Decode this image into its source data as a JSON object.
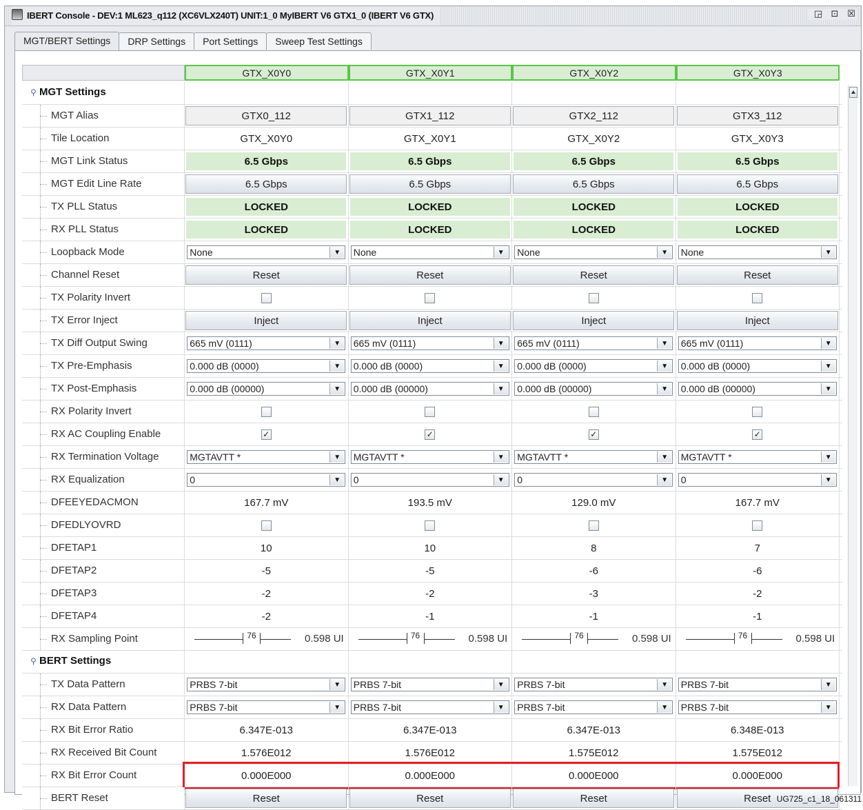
{
  "window": {
    "title": "IBERT Console - DEV:1 ML623_q112 (XC6VLX240T) UNIT:1_0 MyIBERT V6 GTX1_0 (IBERT V6 GTX)",
    "buttons": [
      "◲",
      "⊡",
      "☒"
    ]
  },
  "tabs": [
    "MGT/BERT Settings",
    "DRP Settings",
    "Port Settings",
    "Sweep Test Settings"
  ],
  "columns": [
    "GTX_X0Y0",
    "GTX_X0Y1",
    "GTX_X0Y2",
    "GTX_X0Y3"
  ],
  "sections": {
    "mgt": "MGT Settings",
    "bert": "BERT Settings"
  },
  "rows": [
    {
      "label": "MGT Alias",
      "kind": "alias",
      "values": [
        "GTX0_112",
        "GTX1_112",
        "GTX2_112",
        "GTX3_112"
      ]
    },
    {
      "label": "Tile Location",
      "kind": "text",
      "values": [
        "GTX_X0Y0",
        "GTX_X0Y1",
        "GTX_X0Y2",
        "GTX_X0Y3"
      ]
    },
    {
      "label": "MGT Link Status",
      "kind": "status",
      "values": [
        "6.5 Gbps",
        "6.5 Gbps",
        "6.5 Gbps",
        "6.5 Gbps"
      ]
    },
    {
      "label": "MGT Edit Line Rate",
      "kind": "button",
      "values": [
        "6.5 Gbps",
        "6.5 Gbps",
        "6.5 Gbps",
        "6.5 Gbps"
      ]
    },
    {
      "label": "TX PLL Status",
      "kind": "status",
      "values": [
        "LOCKED",
        "LOCKED",
        "LOCKED",
        "LOCKED"
      ]
    },
    {
      "label": "RX PLL Status",
      "kind": "status",
      "values": [
        "LOCKED",
        "LOCKED",
        "LOCKED",
        "LOCKED"
      ]
    },
    {
      "label": "Loopback Mode",
      "kind": "combo",
      "values": [
        "None",
        "None",
        "None",
        "None"
      ]
    },
    {
      "label": "Channel Reset",
      "kind": "button",
      "values": [
        "Reset",
        "Reset",
        "Reset",
        "Reset"
      ]
    },
    {
      "label": "TX Polarity Invert",
      "kind": "check",
      "values": [
        "",
        "",
        "",
        ""
      ]
    },
    {
      "label": "TX Error Inject",
      "kind": "button",
      "values": [
        "Inject",
        "Inject",
        "Inject",
        "Inject"
      ]
    },
    {
      "label": "TX Diff Output Swing",
      "kind": "combo",
      "values": [
        "665 mV (0111)",
        "665 mV (0111)",
        "665 mV (0111)",
        "665 mV (0111)"
      ]
    },
    {
      "label": "TX Pre-Emphasis",
      "kind": "combo",
      "values": [
        "0.000 dB (0000)",
        "0.000 dB (0000)",
        "0.000 dB (0000)",
        "0.000 dB (0000)"
      ]
    },
    {
      "label": "TX Post-Emphasis",
      "kind": "combo",
      "values": [
        "0.000 dB (00000)",
        "0.000 dB (00000)",
        "0.000 dB (00000)",
        "0.000 dB (00000)"
      ]
    },
    {
      "label": "RX Polarity Invert",
      "kind": "check",
      "values": [
        "",
        "",
        "",
        ""
      ]
    },
    {
      "label": "RX AC Coupling Enable",
      "kind": "check",
      "values": [
        "✓",
        "✓",
        "✓",
        "✓"
      ]
    },
    {
      "label": "RX Termination Voltage",
      "kind": "combo",
      "values": [
        "MGTAVTT  *",
        "MGTAVTT  *",
        "MGTAVTT  *",
        "MGTAVTT  *"
      ]
    },
    {
      "label": "RX Equalization",
      "kind": "combo",
      "values": [
        "0",
        "0",
        "0",
        "0"
      ]
    },
    {
      "label": "DFEEYEDACMON",
      "kind": "text",
      "values": [
        "167.7 mV",
        "193.5 mV",
        "129.0 mV",
        "167.7 mV"
      ]
    },
    {
      "label": "DFEDLYOVRD",
      "kind": "check",
      "values": [
        "",
        "",
        "",
        ""
      ]
    },
    {
      "label": "DFETAP1",
      "kind": "text",
      "values": [
        "10",
        "10",
        "8",
        "7"
      ]
    },
    {
      "label": "DFETAP2",
      "kind": "text",
      "values": [
        "-5",
        "-5",
        "-6",
        "-6"
      ]
    },
    {
      "label": "DFETAP3",
      "kind": "text",
      "values": [
        "-2",
        "-2",
        "-3",
        "-2"
      ]
    },
    {
      "label": "DFETAP4",
      "kind": "text",
      "values": [
        "-2",
        "-1",
        "-1",
        "-1"
      ]
    },
    {
      "label": "RX Sampling Point",
      "kind": "slider",
      "values": [
        "76",
        "76",
        "76",
        "76"
      ],
      "units": [
        "0.598 UI",
        "0.598 UI",
        "0.598 UI",
        "0.598 UI"
      ]
    },
    {
      "section": "bert"
    },
    {
      "label": "TX Data Pattern",
      "kind": "combo",
      "values": [
        "PRBS 7-bit",
        "PRBS 7-bit",
        "PRBS 7-bit",
        "PRBS 7-bit"
      ]
    },
    {
      "label": "RX Data Pattern",
      "kind": "combo",
      "values": [
        "PRBS 7-bit",
        "PRBS 7-bit",
        "PRBS 7-bit",
        "PRBS 7-bit"
      ]
    },
    {
      "label": "RX Bit Error Ratio",
      "kind": "text",
      "values": [
        "6.347E-013",
        "6.347E-013",
        "6.347E-013",
        "6.348E-013"
      ]
    },
    {
      "label": "RX Received Bit Count",
      "kind": "text",
      "values": [
        "1.576E012",
        "1.576E012",
        "1.575E012",
        "1.575E012"
      ]
    },
    {
      "label": "RX Bit Error Count",
      "kind": "text",
      "values": [
        "0.000E000",
        "0.000E000",
        "0.000E000",
        "0.000E000"
      ]
    },
    {
      "label": "BERT Reset",
      "kind": "button",
      "values": [
        "Reset",
        "Reset",
        "Reset",
        "Reset"
      ]
    }
  ],
  "highlight_row": "RX Bit Error Count",
  "footer": "UG725_c1_18_061311",
  "colors": {
    "status_bg": "#d8edd2",
    "header_border": "#5cc44a",
    "highlight": "#e01f26"
  }
}
